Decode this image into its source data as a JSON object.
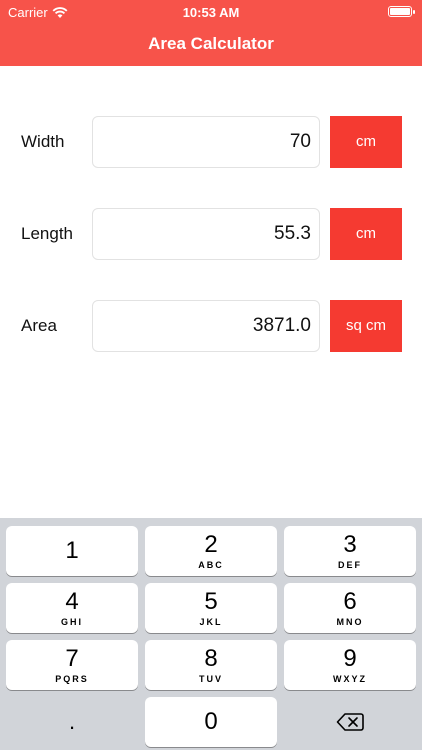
{
  "status_bar": {
    "carrier": "Carrier",
    "time": "10:53 AM"
  },
  "nav": {
    "title": "Area Calculator"
  },
  "rows": [
    {
      "label": "Width",
      "value": "70",
      "unit": "cm"
    },
    {
      "label": "Length",
      "value": "55.3",
      "unit": "cm"
    },
    {
      "label": "Area",
      "value": "3871.0",
      "unit": "sq cm"
    }
  ],
  "keypad": {
    "keys": [
      {
        "digit": "1",
        "letters": ""
      },
      {
        "digit": "2",
        "letters": "ABC"
      },
      {
        "digit": "3",
        "letters": "DEF"
      },
      {
        "digit": "4",
        "letters": "GHI"
      },
      {
        "digit": "5",
        "letters": "JKL"
      },
      {
        "digit": "6",
        "letters": "MNO"
      },
      {
        "digit": "7",
        "letters": "PQRS"
      },
      {
        "digit": "8",
        "letters": "TUV"
      },
      {
        "digit": "9",
        "letters": "WXYZ"
      },
      {
        "digit": ".",
        "letters": ""
      },
      {
        "digit": "0",
        "letters": ""
      }
    ],
    "backspace_icon": "backspace-icon"
  },
  "colors": {
    "header": "#f7534a",
    "unit_button": "#f53a31",
    "keyboard_bg": "#d1d4d9"
  }
}
